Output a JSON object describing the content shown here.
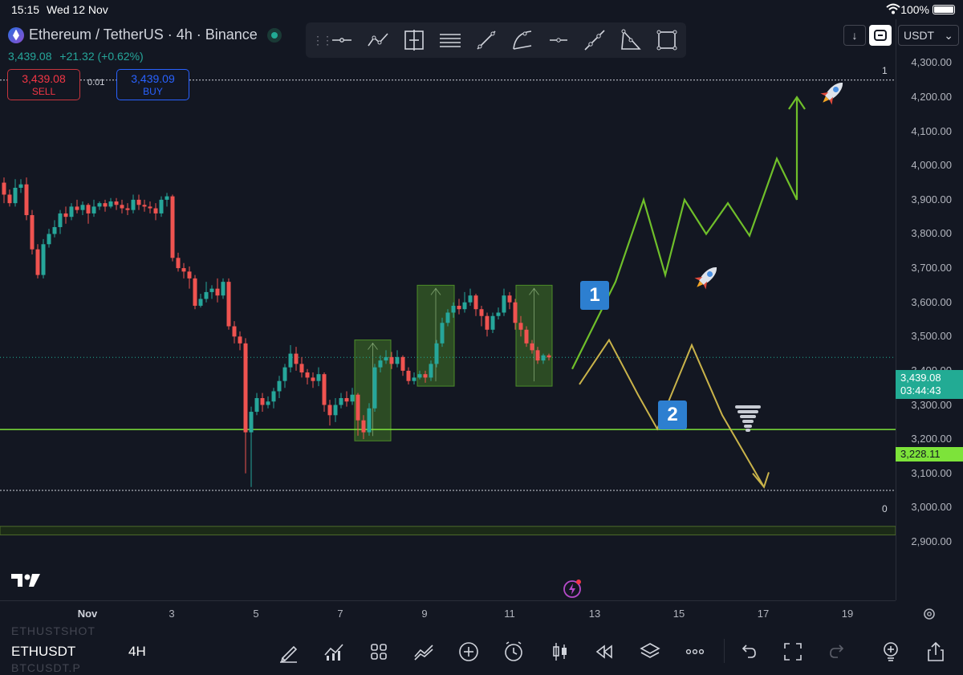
{
  "status_bar": {
    "time": "15:15",
    "date": "Wed 12 Nov",
    "battery": "100%"
  },
  "symbol": {
    "title": "Ethereum / TetherUS · 4h · Binance",
    "last_price": "3,439.08",
    "change": "+21.32 (+0.62%)"
  },
  "trade": {
    "sell_price": "3,439.08",
    "sell_label": "SELL",
    "spread": "0.01",
    "buy_price": "3,439.09",
    "buy_label": "BUY"
  },
  "drawing_tools": [
    "horizontal-line-icon",
    "polyline-icon",
    "fixed-range-icon",
    "parallel-channel-icon",
    "trend-line-icon",
    "arc-icon",
    "horizontal-ray-icon",
    "extended-line-icon",
    "triangle-icon",
    "rectangle-icon"
  ],
  "currency": "USDT",
  "price_axis": {
    "ticks": [
      "4,300.00",
      "4,200.00",
      "4,100.00",
      "4,000.00",
      "3,900.00",
      "3,800.00",
      "3,700.00",
      "3,600.00",
      "3,500.00",
      "3,400.00",
      "3,300.00",
      "3,200.00",
      "3,100.00",
      "3,000.00",
      "2,900.00"
    ],
    "current_price": "3,439.08",
    "countdown": "03:44:43",
    "support_level": "3,228.11"
  },
  "time_axis": [
    "Nov",
    "3",
    "5",
    "7",
    "9",
    "11",
    "13",
    "15",
    "17",
    "19"
  ],
  "fib_labels": {
    "top": "1",
    "bottom": "0"
  },
  "scenario_badges": {
    "one": "1",
    "two": "2"
  },
  "bottom_bar": {
    "ghost_top": "ETHUSTSHOT",
    "symbol": "ETHUSDT",
    "timeframe": "4H",
    "ghost_bottom": "BTCUSDT.P",
    "icons": [
      "draw-icon",
      "indicators-icon",
      "layouts-icon",
      "compare-icon",
      "add-icon",
      "alert-icon",
      "candle-type-icon",
      "replay-icon",
      "layers-icon",
      "more-icon",
      "undo-icon",
      "fullscreen-icon",
      "redo-icon",
      "ideas-icon",
      "share-icon"
    ]
  },
  "colors": {
    "up": "#26a69a",
    "down": "#ef5350",
    "bull_path": "#6fbf2a",
    "bear_path": "#c9b34a",
    "support": "#7de33a",
    "background": "#131722"
  },
  "chart_data": {
    "type": "candlestick",
    "ylim": [
      2860,
      4355
    ],
    "x_ticks": [
      "Nov",
      "3",
      "5",
      "7",
      "9",
      "11",
      "13",
      "15",
      "17",
      "19"
    ],
    "candles": [
      [
        3950,
        3915,
        3965,
        3890
      ],
      [
        3915,
        3890,
        3930,
        3880
      ],
      [
        3890,
        3935,
        3960,
        3880
      ],
      [
        3935,
        3945,
        3960,
        3920
      ],
      [
        3945,
        3855,
        3965,
        3840
      ],
      [
        3855,
        3755,
        3870,
        3740
      ],
      [
        3755,
        3680,
        3770,
        3670
      ],
      [
        3680,
        3770,
        3785,
        3670
      ],
      [
        3770,
        3800,
        3815,
        3760
      ],
      [
        3800,
        3820,
        3840,
        3790
      ],
      [
        3820,
        3860,
        3870,
        3800
      ],
      [
        3860,
        3850,
        3880,
        3830
      ],
      [
        3850,
        3880,
        3890,
        3840
      ],
      [
        3880,
        3870,
        3900,
        3860
      ],
      [
        3870,
        3885,
        3895,
        3855
      ],
      [
        3885,
        3860,
        3890,
        3830
      ],
      [
        3860,
        3880,
        3900,
        3850
      ],
      [
        3880,
        3890,
        3895,
        3870
      ],
      [
        3890,
        3880,
        3900,
        3865
      ],
      [
        3880,
        3895,
        3905,
        3875
      ],
      [
        3895,
        3885,
        3905,
        3870
      ],
      [
        3885,
        3875,
        3900,
        3860
      ],
      [
        3875,
        3870,
        3890,
        3855
      ],
      [
        3870,
        3900,
        3915,
        3860
      ],
      [
        3900,
        3885,
        3915,
        3870
      ],
      [
        3885,
        3880,
        3900,
        3865
      ],
      [
        3880,
        3875,
        3895,
        3860
      ],
      [
        3875,
        3860,
        3890,
        3840
      ],
      [
        3860,
        3900,
        3910,
        3850
      ],
      [
        3900,
        3910,
        3920,
        3880
      ],
      [
        3910,
        3730,
        3915,
        3720
      ],
      [
        3730,
        3700,
        3745,
        3690
      ],
      [
        3700,
        3690,
        3715,
        3670
      ],
      [
        3690,
        3670,
        3705,
        3640
      ],
      [
        3670,
        3590,
        3680,
        3580
      ],
      [
        3590,
        3610,
        3625,
        3585
      ],
      [
        3610,
        3630,
        3660,
        3600
      ],
      [
        3630,
        3640,
        3650,
        3610
      ],
      [
        3640,
        3620,
        3670,
        3600
      ],
      [
        3620,
        3660,
        3670,
        3610
      ],
      [
        3660,
        3530,
        3670,
        3520
      ],
      [
        3530,
        3500,
        3545,
        3480
      ],
      [
        3500,
        3480,
        3515,
        3460
      ],
      [
        3480,
        3220,
        3495,
        3100
      ],
      [
        3220,
        3280,
        3295,
        3060
      ],
      [
        3280,
        3320,
        3335,
        3270
      ],
      [
        3320,
        3300,
        3335,
        3280
      ],
      [
        3300,
        3310,
        3325,
        3290
      ],
      [
        3310,
        3340,
        3350,
        3290
      ],
      [
        3340,
        3370,
        3385,
        3320
      ],
      [
        3370,
        3410,
        3420,
        3350
      ],
      [
        3410,
        3450,
        3475,
        3395
      ],
      [
        3450,
        3420,
        3470,
        3400
      ],
      [
        3420,
        3395,
        3440,
        3380
      ],
      [
        3395,
        3380,
        3405,
        3360
      ],
      [
        3380,
        3370,
        3395,
        3350
      ],
      [
        3370,
        3390,
        3410,
        3355
      ],
      [
        3390,
        3300,
        3395,
        3280
      ],
      [
        3300,
        3270,
        3315,
        3240
      ],
      [
        3270,
        3300,
        3320,
        3250
      ],
      [
        3300,
        3320,
        3335,
        3290
      ],
      [
        3320,
        3310,
        3340,
        3295
      ],
      [
        3310,
        3330,
        3350,
        3300
      ],
      [
        3330,
        3255,
        3335,
        3210
      ],
      [
        3255,
        3220,
        3270,
        3200
      ],
      [
        3220,
        3290,
        3305,
        3210
      ],
      [
        3290,
        3410,
        3420,
        3280
      ],
      [
        3410,
        3430,
        3445,
        3395
      ],
      [
        3430,
        3440,
        3460,
        3420
      ],
      [
        3440,
        3420,
        3455,
        3405
      ],
      [
        3420,
        3440,
        3460,
        3410
      ],
      [
        3440,
        3400,
        3445,
        3385
      ],
      [
        3400,
        3370,
        3410,
        3360
      ],
      [
        3370,
        3380,
        3395,
        3360
      ],
      [
        3380,
        3390,
        3400,
        3375
      ],
      [
        3390,
        3380,
        3400,
        3365
      ],
      [
        3380,
        3420,
        3430,
        3370
      ],
      [
        3420,
        3480,
        3490,
        3410
      ],
      [
        3480,
        3540,
        3555,
        3470
      ],
      [
        3540,
        3570,
        3580,
        3530
      ],
      [
        3570,
        3590,
        3600,
        3555
      ],
      [
        3590,
        3580,
        3610,
        3565
      ],
      [
        3580,
        3600,
        3630,
        3570
      ],
      [
        3600,
        3620,
        3640,
        3590
      ],
      [
        3620,
        3580,
        3625,
        3560
      ],
      [
        3580,
        3560,
        3590,
        3530
      ],
      [
        3560,
        3520,
        3570,
        3500
      ],
      [
        3520,
        3560,
        3570,
        3510
      ],
      [
        3560,
        3570,
        3585,
        3550
      ],
      [
        3570,
        3620,
        3640,
        3560
      ],
      [
        3620,
        3600,
        3630,
        3580
      ],
      [
        3600,
        3540,
        3610,
        3520
      ],
      [
        3540,
        3520,
        3560,
        3500
      ],
      [
        3520,
        3480,
        3530,
        3470
      ],
      [
        3480,
        3460,
        3490,
        3450
      ],
      [
        3460,
        3430,
        3470,
        3420
      ],
      [
        3430,
        3445,
        3450,
        3420
      ],
      [
        3445,
        3439,
        3450,
        3430
      ]
    ],
    "support_level": 3228.11,
    "fib_1": 4250,
    "fib_0": 3050,
    "band": [
      2920,
      2945
    ],
    "scenario_1_path": [
      3405,
      3660,
      3900,
      3680,
      3900,
      3800,
      3890,
      3795,
      4020,
      3900,
      4200
    ],
    "scenario_2_path": [
      3360,
      3490,
      3330,
      3230,
      3475,
      3270,
      3060
    ]
  }
}
